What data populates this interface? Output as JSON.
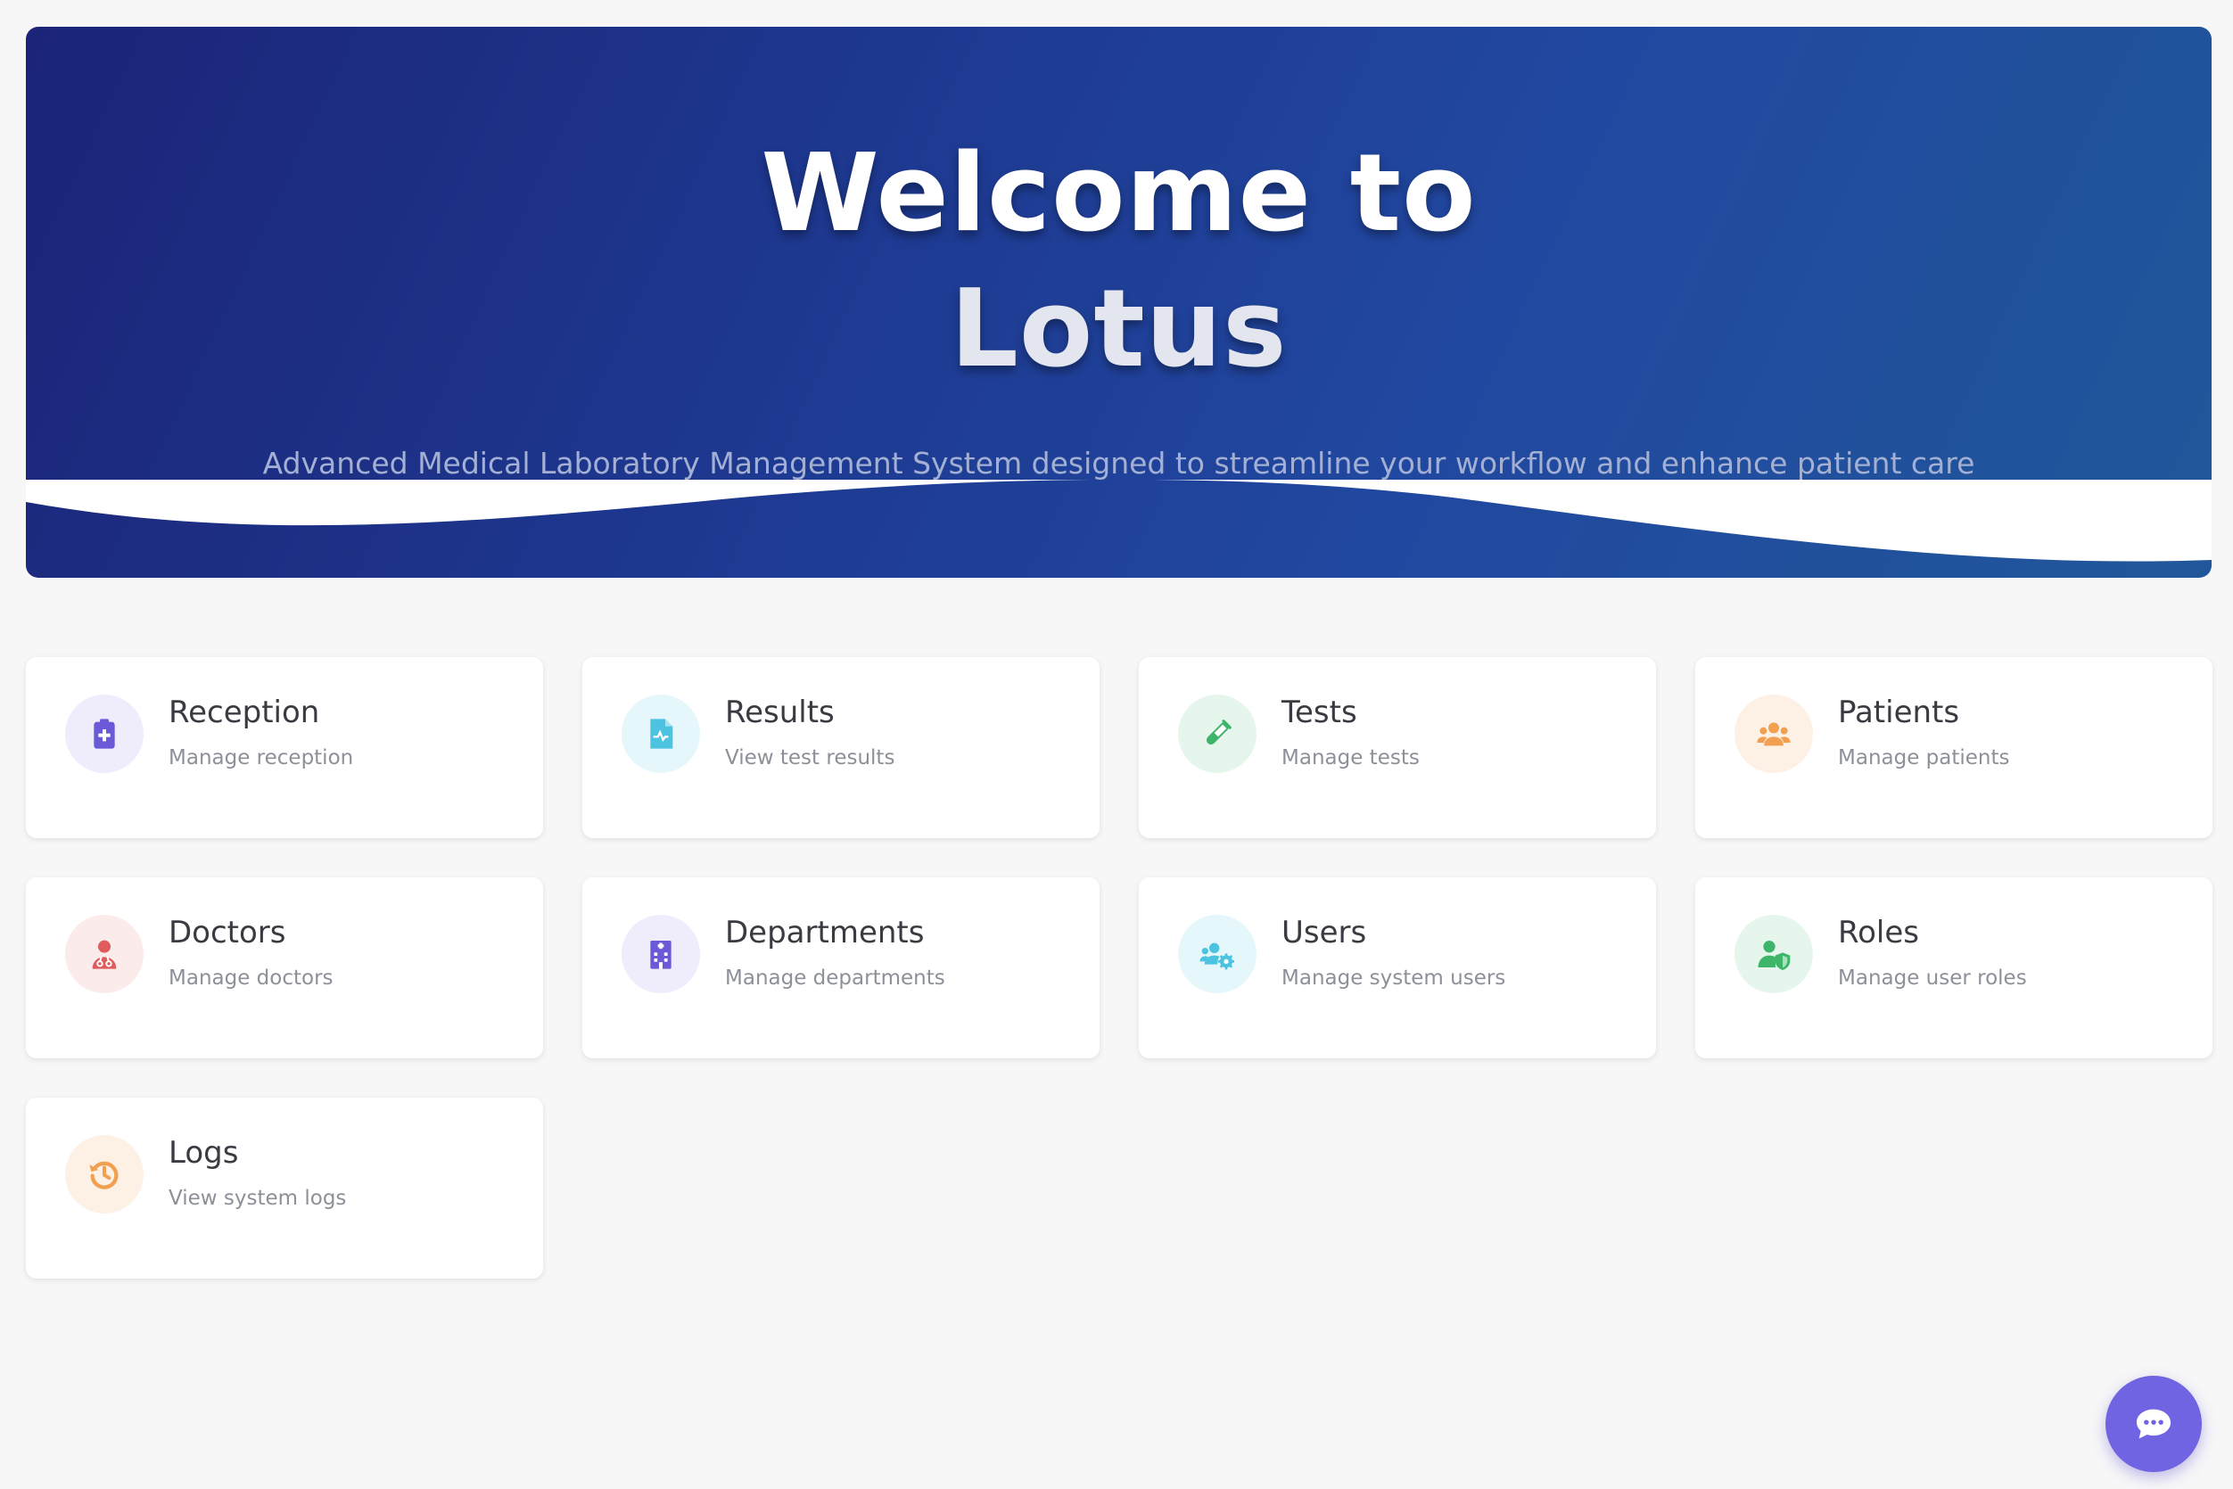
{
  "hero": {
    "title_line1": "Welcome to",
    "title_line2": "Lotus",
    "subtitle": "Advanced Medical Laboratory Management System designed to streamline your workflow and enhance patient care"
  },
  "cards": [
    {
      "title": "Reception",
      "description": "Manage reception",
      "icon": "clipboard-medical-icon",
      "color": "#6a5ad8",
      "bg": "#efecfc"
    },
    {
      "title": "Results",
      "description": "View test results",
      "icon": "file-medical-icon",
      "color": "#4cc3e0",
      "bg": "#e6f7fb"
    },
    {
      "title": "Tests",
      "description": "Manage tests",
      "icon": "test-tube-icon",
      "color": "#3fb56a",
      "bg": "#e7f6ec"
    },
    {
      "title": "Patients",
      "description": "Manage patients",
      "icon": "users-icon",
      "color": "#f0a050",
      "bg": "#fdf1e6"
    },
    {
      "title": "Doctors",
      "description": "Manage doctors",
      "icon": "doctor-icon",
      "color": "#e05b5b",
      "bg": "#fcebeb"
    },
    {
      "title": "Departments",
      "description": "Manage departments",
      "icon": "hospital-building-icon",
      "color": "#6a5ad8",
      "bg": "#efecfc"
    },
    {
      "title": "Users",
      "description": "Manage system users",
      "icon": "users-cog-icon",
      "color": "#4cc3e0",
      "bg": "#e6f7fb"
    },
    {
      "title": "Roles",
      "description": "Manage user roles",
      "icon": "user-shield-icon",
      "color": "#3fb56a",
      "bg": "#e7f6ec"
    },
    {
      "title": "Logs",
      "description": "View system logs",
      "icon": "history-icon",
      "color": "#f0a050",
      "bg": "#fdf1e6"
    }
  ],
  "chat": {
    "icon": "chat-bubble-icon",
    "color": "#7064e2"
  }
}
